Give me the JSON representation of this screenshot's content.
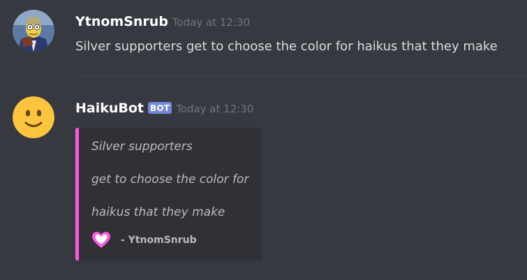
{
  "messages": [
    {
      "username": "YtnomSnrub",
      "timestamp": "Today at 12:30",
      "content": "Silver supporters get to choose the color for haikus that they make",
      "avatar_icon": "user-avatar"
    },
    {
      "username": "HaikuBot",
      "bot_tag": "BOT",
      "timestamp": "Today at 12:30",
      "avatar_icon": "slightly-smiling-face-emoji",
      "embed": {
        "accent_color": "#ff55e2",
        "lines": [
          "Silver supporters",
          "get to choose the color for",
          "haikus that they make"
        ],
        "footer_icon": "pink-heart-icon",
        "footer_text": "- YtnomSnrub"
      }
    }
  ],
  "colors": {
    "background": "#36393f",
    "embed_background": "#2f3136",
    "bot_tag": "#7289da",
    "timestamp": "#72767d"
  }
}
